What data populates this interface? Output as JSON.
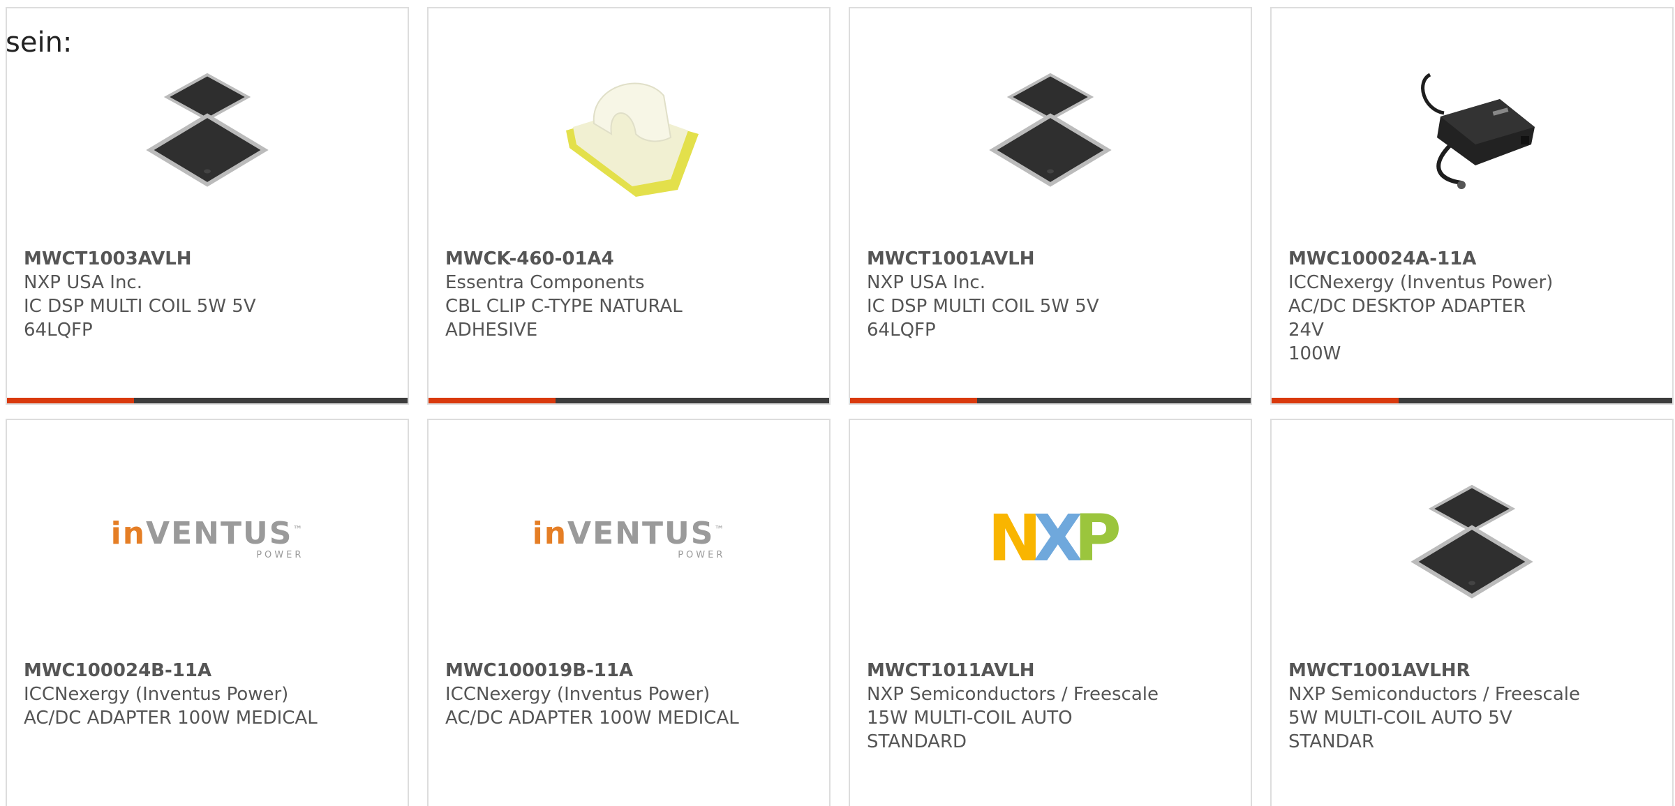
{
  "intro": "sein:",
  "products": [
    {
      "part": "MWCT1003AVLH",
      "maker": "NXP USA Inc.",
      "desc1": "IC DSP MULTI COIL 5W 5V",
      "desc2": "64LQFP",
      "image": "qfp-chip-image",
      "accent": true
    },
    {
      "part": "MWCK-460-01A4",
      "maker": "Essentra Components",
      "desc1": "CBL CLIP C-TYPE NATURAL",
      "desc2": "ADHESIVE",
      "image": "cable-clip-image",
      "accent": true
    },
    {
      "part": "MWCT1001AVLH",
      "maker": "NXP USA Inc.",
      "desc1": "IC DSP MULTI COIL 5W 5V",
      "desc2": "64LQFP",
      "image": "qfp-chip-image",
      "accent": true
    },
    {
      "part": "MWC100024A-11A",
      "maker": "ICCNexergy (Inventus Power)",
      "desc1": "AC/DC DESKTOP ADAPTER 24V",
      "desc2": "100W",
      "image": "desktop-adapter-image",
      "accent": true
    },
    {
      "part": "MWC100024B-11A",
      "maker": "ICCNexergy (Inventus Power)",
      "desc1": "AC/DC ADAPTER 100W MEDICAL",
      "desc2": "",
      "image": "inventus-logo",
      "logo": {
        "in": "in",
        "ventus": "VENTUS",
        "tm": "™",
        "power": "POWER"
      },
      "accent": false
    },
    {
      "part": "MWC100019B-11A",
      "maker": "ICCNexergy (Inventus Power)",
      "desc1": "AC/DC ADAPTER 100W MEDICAL",
      "desc2": "",
      "image": "inventus-logo",
      "logo": {
        "in": "in",
        "ventus": "VENTUS",
        "tm": "™",
        "power": "POWER"
      },
      "accent": false
    },
    {
      "part": "MWCT1011AVLH",
      "maker": "NXP Semiconductors / Freescale",
      "desc1": "15W MULTI-COIL AUTO",
      "desc2": "STANDARD",
      "image": "nxp-logo",
      "logo": {
        "n": "N",
        "x": "X",
        "p": "P"
      },
      "accent": false
    },
    {
      "part": "MWCT1001AVLHR",
      "maker": "NXP Semiconductors / Freescale",
      "desc1": "5W MULTI-COIL AUTO 5V",
      "desc2": "STANDAR",
      "image": "qfp-chip-image",
      "accent": false
    }
  ],
  "colors": {
    "accent_red": "#d9390d",
    "bar_dark": "#3c3c3c",
    "card_border": "#dddddd",
    "text_gray": "#555555"
  }
}
